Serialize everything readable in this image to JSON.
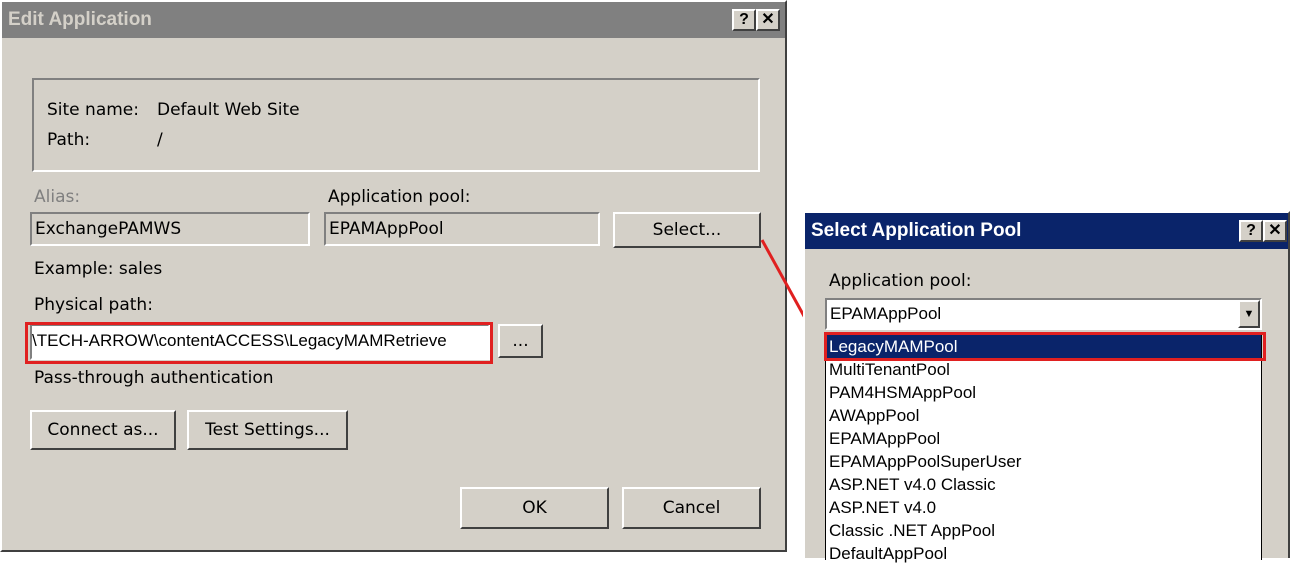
{
  "edit_dialog": {
    "title": "Edit Application",
    "help_btn": "?",
    "close_btn": "✕",
    "site_name_label": "Site name:",
    "site_name_value": "Default Web Site",
    "path_label": "Path:",
    "path_value": "/",
    "alias_label": "Alias:",
    "alias_value": "ExchangePAMWS",
    "app_pool_label": "Application pool:",
    "app_pool_value": "EPAMAppPool",
    "select_button": "Select...",
    "example_text": "Example: sales",
    "physical_path_label": "Physical path:",
    "physical_path_value": "\\TECH-ARROW\\contentACCESS\\LegacyMAMRetrieve",
    "browse_button": "...",
    "passthrough_text": "Pass-through authentication",
    "connect_as_button": "Connect as...",
    "test_settings_button": "Test Settings...",
    "ok_button": "OK",
    "cancel_button": "Cancel"
  },
  "select_dialog": {
    "title": "Select Application Pool",
    "help_btn": "?",
    "close_btn": "✕",
    "app_pool_label": "Application pool:",
    "combo_value": "EPAMAppPool",
    "options": [
      "LegacyMAMPool",
      "MultiTenantPool",
      "PAM4HSMAppPool",
      "AWAppPool",
      "EPAMAppPool",
      "EPAMAppPoolSuperUser",
      "ASP.NET v4.0 Classic",
      "ASP.NET v4.0",
      "Classic .NET AppPool",
      "DefaultAppPool"
    ],
    "selected_option": "LegacyMAMPool"
  },
  "colors": {
    "highlight": "#e02020",
    "active_title": "#0a246a",
    "inactive_title": "#808080"
  }
}
